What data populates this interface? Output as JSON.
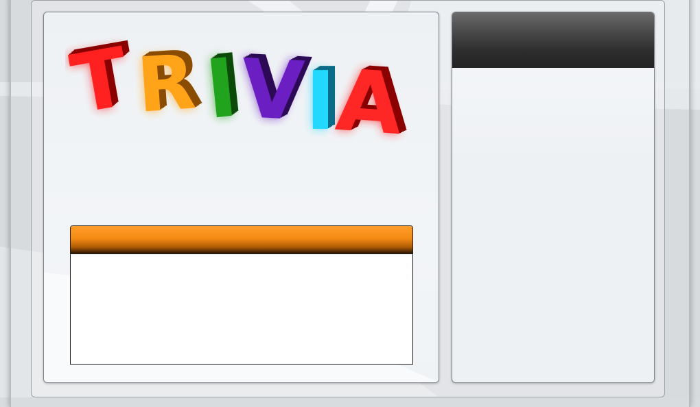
{
  "logo": {
    "icon": "trivia-logo-icon",
    "letters": [
      {
        "char": "T",
        "color": "#ff2020",
        "side": "#8a0000"
      },
      {
        "char": "R",
        "color": "#ffa318",
        "side": "#8a4c00"
      },
      {
        "char": "I",
        "color": "#22a31e",
        "side": "#0c4a0a"
      },
      {
        "char": "V",
        "color": "#6b1fc2",
        "side": "#2c0a55"
      },
      {
        "char": "I",
        "color": "#22d8ff",
        "side": "#0a6c86"
      },
      {
        "char": "A",
        "color": "#ff2626",
        "side": "#8a0000"
      }
    ]
  },
  "answer_panel": {
    "title": ""
  },
  "side_panel": {
    "title": ""
  },
  "colors": {
    "answer_header": "#f48b14",
    "side_header": "#2e2e2e",
    "panel_bg": "#eef1f4"
  }
}
